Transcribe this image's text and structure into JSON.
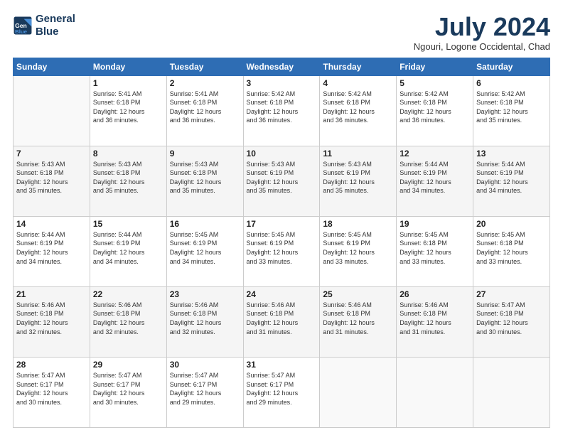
{
  "header": {
    "logo_line1": "General",
    "logo_line2": "Blue",
    "month_title": "July 2024",
    "location": "Ngouri, Logone Occidental, Chad"
  },
  "weekdays": [
    "Sunday",
    "Monday",
    "Tuesday",
    "Wednesday",
    "Thursday",
    "Friday",
    "Saturday"
  ],
  "weeks": [
    [
      {
        "day": "",
        "info": ""
      },
      {
        "day": "1",
        "info": "Sunrise: 5:41 AM\nSunset: 6:18 PM\nDaylight: 12 hours\nand 36 minutes."
      },
      {
        "day": "2",
        "info": "Sunrise: 5:41 AM\nSunset: 6:18 PM\nDaylight: 12 hours\nand 36 minutes."
      },
      {
        "day": "3",
        "info": "Sunrise: 5:42 AM\nSunset: 6:18 PM\nDaylight: 12 hours\nand 36 minutes."
      },
      {
        "day": "4",
        "info": "Sunrise: 5:42 AM\nSunset: 6:18 PM\nDaylight: 12 hours\nand 36 minutes."
      },
      {
        "day": "5",
        "info": "Sunrise: 5:42 AM\nSunset: 6:18 PM\nDaylight: 12 hours\nand 36 minutes."
      },
      {
        "day": "6",
        "info": "Sunrise: 5:42 AM\nSunset: 6:18 PM\nDaylight: 12 hours\nand 35 minutes."
      }
    ],
    [
      {
        "day": "7",
        "info": "Sunrise: 5:43 AM\nSunset: 6:18 PM\nDaylight: 12 hours\nand 35 minutes."
      },
      {
        "day": "8",
        "info": "Sunrise: 5:43 AM\nSunset: 6:18 PM\nDaylight: 12 hours\nand 35 minutes."
      },
      {
        "day": "9",
        "info": "Sunrise: 5:43 AM\nSunset: 6:18 PM\nDaylight: 12 hours\nand 35 minutes."
      },
      {
        "day": "10",
        "info": "Sunrise: 5:43 AM\nSunset: 6:19 PM\nDaylight: 12 hours\nand 35 minutes."
      },
      {
        "day": "11",
        "info": "Sunrise: 5:43 AM\nSunset: 6:19 PM\nDaylight: 12 hours\nand 35 minutes."
      },
      {
        "day": "12",
        "info": "Sunrise: 5:44 AM\nSunset: 6:19 PM\nDaylight: 12 hours\nand 34 minutes."
      },
      {
        "day": "13",
        "info": "Sunrise: 5:44 AM\nSunset: 6:19 PM\nDaylight: 12 hours\nand 34 minutes."
      }
    ],
    [
      {
        "day": "14",
        "info": "Sunrise: 5:44 AM\nSunset: 6:19 PM\nDaylight: 12 hours\nand 34 minutes."
      },
      {
        "day": "15",
        "info": "Sunrise: 5:44 AM\nSunset: 6:19 PM\nDaylight: 12 hours\nand 34 minutes."
      },
      {
        "day": "16",
        "info": "Sunrise: 5:45 AM\nSunset: 6:19 PM\nDaylight: 12 hours\nand 34 minutes."
      },
      {
        "day": "17",
        "info": "Sunrise: 5:45 AM\nSunset: 6:19 PM\nDaylight: 12 hours\nand 33 minutes."
      },
      {
        "day": "18",
        "info": "Sunrise: 5:45 AM\nSunset: 6:19 PM\nDaylight: 12 hours\nand 33 minutes."
      },
      {
        "day": "19",
        "info": "Sunrise: 5:45 AM\nSunset: 6:18 PM\nDaylight: 12 hours\nand 33 minutes."
      },
      {
        "day": "20",
        "info": "Sunrise: 5:45 AM\nSunset: 6:18 PM\nDaylight: 12 hours\nand 33 minutes."
      }
    ],
    [
      {
        "day": "21",
        "info": "Sunrise: 5:46 AM\nSunset: 6:18 PM\nDaylight: 12 hours\nand 32 minutes."
      },
      {
        "day": "22",
        "info": "Sunrise: 5:46 AM\nSunset: 6:18 PM\nDaylight: 12 hours\nand 32 minutes."
      },
      {
        "day": "23",
        "info": "Sunrise: 5:46 AM\nSunset: 6:18 PM\nDaylight: 12 hours\nand 32 minutes."
      },
      {
        "day": "24",
        "info": "Sunrise: 5:46 AM\nSunset: 6:18 PM\nDaylight: 12 hours\nand 31 minutes."
      },
      {
        "day": "25",
        "info": "Sunrise: 5:46 AM\nSunset: 6:18 PM\nDaylight: 12 hours\nand 31 minutes."
      },
      {
        "day": "26",
        "info": "Sunrise: 5:46 AM\nSunset: 6:18 PM\nDaylight: 12 hours\nand 31 minutes."
      },
      {
        "day": "27",
        "info": "Sunrise: 5:47 AM\nSunset: 6:18 PM\nDaylight: 12 hours\nand 30 minutes."
      }
    ],
    [
      {
        "day": "28",
        "info": "Sunrise: 5:47 AM\nSunset: 6:17 PM\nDaylight: 12 hours\nand 30 minutes."
      },
      {
        "day": "29",
        "info": "Sunrise: 5:47 AM\nSunset: 6:17 PM\nDaylight: 12 hours\nand 30 minutes."
      },
      {
        "day": "30",
        "info": "Sunrise: 5:47 AM\nSunset: 6:17 PM\nDaylight: 12 hours\nand 29 minutes."
      },
      {
        "day": "31",
        "info": "Sunrise: 5:47 AM\nSunset: 6:17 PM\nDaylight: 12 hours\nand 29 minutes."
      },
      {
        "day": "",
        "info": ""
      },
      {
        "day": "",
        "info": ""
      },
      {
        "day": "",
        "info": ""
      }
    ]
  ]
}
